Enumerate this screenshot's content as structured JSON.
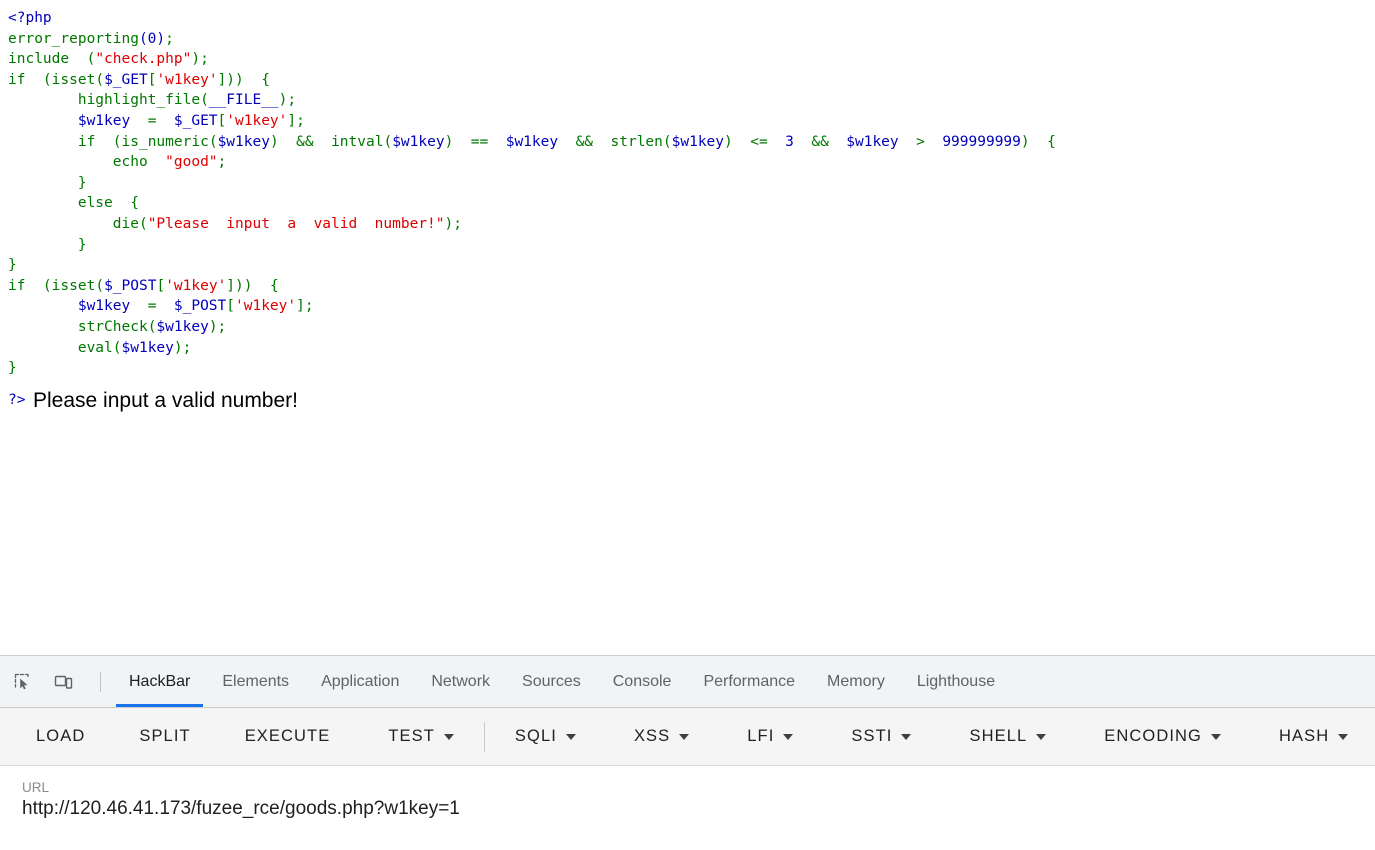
{
  "page": {
    "code_lines": [
      [
        {
          "t": "<?php",
          "c": "default"
        }
      ],
      [
        {
          "t": "error_reporting",
          "c": "keyword"
        },
        {
          "t": "(0)",
          "c": "default"
        },
        {
          "t": ";",
          "c": "keyword"
        }
      ],
      [
        {
          "t": "include",
          "c": "keyword"
        },
        {
          "t": "  (",
          "c": "keyword"
        },
        {
          "t": "\"check.php\"",
          "c": "string"
        },
        {
          "t": ")",
          "c": "keyword"
        },
        {
          "t": ";",
          "c": "keyword"
        }
      ],
      [
        {
          "t": "if",
          "c": "keyword"
        },
        {
          "t": "  (",
          "c": "keyword"
        },
        {
          "t": "isset",
          "c": "keyword"
        },
        {
          "t": "(",
          "c": "keyword"
        },
        {
          "t": "$_GET",
          "c": "default"
        },
        {
          "t": "[",
          "c": "keyword"
        },
        {
          "t": "'w1key'",
          "c": "string"
        },
        {
          "t": "]",
          "c": "keyword"
        },
        {
          "t": "))  {",
          "c": "keyword"
        }
      ],
      [
        {
          "t": "        ",
          "c": "keyword"
        },
        {
          "t": "highlight_file",
          "c": "keyword"
        },
        {
          "t": "(",
          "c": "keyword"
        },
        {
          "t": "__FILE__",
          "c": "default"
        },
        {
          "t": ")",
          "c": "keyword"
        },
        {
          "t": ";",
          "c": "keyword"
        }
      ],
      [
        {
          "t": "        ",
          "c": "keyword"
        },
        {
          "t": "$w1key",
          "c": "default"
        },
        {
          "t": "  =  ",
          "c": "keyword"
        },
        {
          "t": "$_GET",
          "c": "default"
        },
        {
          "t": "[",
          "c": "keyword"
        },
        {
          "t": "'w1key'",
          "c": "string"
        },
        {
          "t": "]",
          "c": "keyword"
        },
        {
          "t": ";",
          "c": "keyword"
        }
      ],
      [
        {
          "t": "        ",
          "c": "keyword"
        },
        {
          "t": "if",
          "c": "keyword"
        },
        {
          "t": "  (",
          "c": "keyword"
        },
        {
          "t": "is_numeric",
          "c": "keyword"
        },
        {
          "t": "(",
          "c": "keyword"
        },
        {
          "t": "$w1key",
          "c": "default"
        },
        {
          "t": ")",
          "c": "keyword"
        },
        {
          "t": "  &&  ",
          "c": "keyword"
        },
        {
          "t": "intval",
          "c": "keyword"
        },
        {
          "t": "(",
          "c": "keyword"
        },
        {
          "t": "$w1key",
          "c": "default"
        },
        {
          "t": ")",
          "c": "keyword"
        },
        {
          "t": "  ==  ",
          "c": "keyword"
        },
        {
          "t": "$w1key",
          "c": "default"
        },
        {
          "t": "  &&  ",
          "c": "keyword"
        },
        {
          "t": "strlen",
          "c": "keyword"
        },
        {
          "t": "(",
          "c": "keyword"
        },
        {
          "t": "$w1key",
          "c": "default"
        },
        {
          "t": ")",
          "c": "keyword"
        },
        {
          "t": "  <=  ",
          "c": "keyword"
        },
        {
          "t": "3",
          "c": "default"
        },
        {
          "t": "  &&  ",
          "c": "keyword"
        },
        {
          "t": "$w1key",
          "c": "default"
        },
        {
          "t": "  >  ",
          "c": "keyword"
        },
        {
          "t": "999999999",
          "c": "default"
        },
        {
          "t": ")  {",
          "c": "keyword"
        }
      ],
      [
        {
          "t": "            ",
          "c": "keyword"
        },
        {
          "t": "echo",
          "c": "keyword"
        },
        {
          "t": "  ",
          "c": "keyword"
        },
        {
          "t": "\"good\"",
          "c": "string"
        },
        {
          "t": ";",
          "c": "keyword"
        }
      ],
      [
        {
          "t": "        }",
          "c": "keyword"
        }
      ],
      [
        {
          "t": "        ",
          "c": "keyword"
        },
        {
          "t": "else",
          "c": "keyword"
        },
        {
          "t": "  {",
          "c": "keyword"
        }
      ],
      [
        {
          "t": "            ",
          "c": "keyword"
        },
        {
          "t": "die",
          "c": "keyword"
        },
        {
          "t": "(",
          "c": "keyword"
        },
        {
          "t": "\"Please  input  a  valid  number!\"",
          "c": "string"
        },
        {
          "t": ")",
          "c": "keyword"
        },
        {
          "t": ";",
          "c": "keyword"
        }
      ],
      [
        {
          "t": "        }",
          "c": "keyword"
        }
      ],
      [
        {
          "t": "}",
          "c": "keyword"
        }
      ],
      [
        {
          "t": "if",
          "c": "keyword"
        },
        {
          "t": "  (",
          "c": "keyword"
        },
        {
          "t": "isset",
          "c": "keyword"
        },
        {
          "t": "(",
          "c": "keyword"
        },
        {
          "t": "$_POST",
          "c": "default"
        },
        {
          "t": "[",
          "c": "keyword"
        },
        {
          "t": "'w1key'",
          "c": "string"
        },
        {
          "t": "]",
          "c": "keyword"
        },
        {
          "t": "))  {",
          "c": "keyword"
        }
      ],
      [
        {
          "t": "        ",
          "c": "keyword"
        },
        {
          "t": "$w1key",
          "c": "default"
        },
        {
          "t": "  =  ",
          "c": "keyword"
        },
        {
          "t": "$_POST",
          "c": "default"
        },
        {
          "t": "[",
          "c": "keyword"
        },
        {
          "t": "'w1key'",
          "c": "string"
        },
        {
          "t": "]",
          "c": "keyword"
        },
        {
          "t": ";",
          "c": "keyword"
        }
      ],
      [
        {
          "t": "        ",
          "c": "keyword"
        },
        {
          "t": "strCheck",
          "c": "keyword"
        },
        {
          "t": "(",
          "c": "keyword"
        },
        {
          "t": "$w1key",
          "c": "default"
        },
        {
          "t": ")",
          "c": "keyword"
        },
        {
          "t": ";",
          "c": "keyword"
        }
      ],
      [
        {
          "t": "        ",
          "c": "keyword"
        },
        {
          "t": "eval",
          "c": "keyword"
        },
        {
          "t": "(",
          "c": "keyword"
        },
        {
          "t": "$w1key",
          "c": "default"
        },
        {
          "t": ")",
          "c": "keyword"
        },
        {
          "t": ";",
          "c": "keyword"
        }
      ],
      [
        {
          "t": "}",
          "c": "keyword"
        }
      ]
    ],
    "php_close_tag": "?>",
    "output_text": "Please input a valid number!",
    "colors": {
      "default": "#0000BB",
      "keyword": "#007700",
      "string": "#DD0000",
      "comment": "#FF8000"
    }
  },
  "devtools": {
    "icons": {
      "inspect": "inspect-element-icon",
      "device": "device-toolbar-icon"
    },
    "tabs": [
      {
        "label": "HackBar",
        "active": true
      },
      {
        "label": "Elements",
        "active": false
      },
      {
        "label": "Application",
        "active": false
      },
      {
        "label": "Network",
        "active": false
      },
      {
        "label": "Sources",
        "active": false
      },
      {
        "label": "Console",
        "active": false
      },
      {
        "label": "Performance",
        "active": false
      },
      {
        "label": "Memory",
        "active": false
      },
      {
        "label": "Lighthouse",
        "active": false
      }
    ],
    "active_tab_accent": "#1a73e8"
  },
  "hackbar": {
    "buttons": [
      {
        "label": "LOAD",
        "dropdown": false
      },
      {
        "label": "SPLIT",
        "dropdown": false
      },
      {
        "label": "EXECUTE",
        "dropdown": false
      },
      {
        "label": "TEST",
        "dropdown": true
      },
      {
        "label": "SQLI",
        "dropdown": true
      },
      {
        "label": "XSS",
        "dropdown": true
      },
      {
        "label": "LFI",
        "dropdown": true
      },
      {
        "label": "SSTI",
        "dropdown": true
      },
      {
        "label": "SHELL",
        "dropdown": true
      },
      {
        "label": "ENCODING",
        "dropdown": true
      },
      {
        "label": "HASH",
        "dropdown": true
      }
    ],
    "url_label": "URL",
    "url_value": "http://120.46.41.173/fuzee_rce/goods.php?w1key=1"
  }
}
